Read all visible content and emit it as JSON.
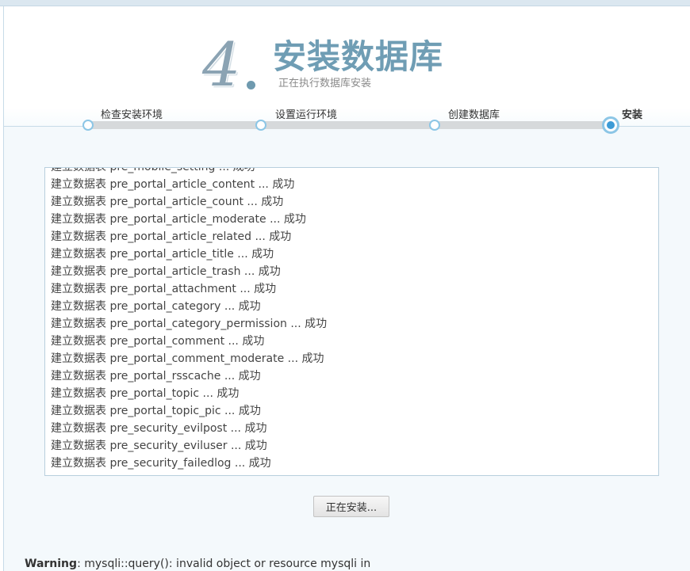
{
  "header": {
    "step_number": "4",
    "title": "安装数据库",
    "subtitle": "正在执行数据库安装"
  },
  "steps": [
    {
      "label": "检查安装环境",
      "state": "done"
    },
    {
      "label": "设置运行环境",
      "state": "done"
    },
    {
      "label": "创建数据库",
      "state": "done"
    },
    {
      "label": "安装",
      "state": "active"
    }
  ],
  "log": {
    "lines": [
      "建立数据表 pre_mobile_setting ... 成功",
      "建立数据表 pre_portal_article_content ... 成功",
      "建立数据表 pre_portal_article_count ... 成功",
      "建立数据表 pre_portal_article_moderate ... 成功",
      "建立数据表 pre_portal_article_related ... 成功",
      "建立数据表 pre_portal_article_title ... 成功",
      "建立数据表 pre_portal_article_trash ... 成功",
      "建立数据表 pre_portal_attachment ... 成功",
      "建立数据表 pre_portal_category ... 成功",
      "建立数据表 pre_portal_category_permission ... 成功",
      "建立数据表 pre_portal_comment ... 成功",
      "建立数据表 pre_portal_comment_moderate ... 成功",
      "建立数据表 pre_portal_rsscache ... 成功",
      "建立数据表 pre_portal_topic ... 成功",
      "建立数据表 pre_portal_topic_pic ... 成功",
      "建立数据表 pre_security_evilpost ... 成功",
      "建立数据表 pre_security_eviluser ... 成功",
      "建立数据表 pre_security_failedlog ... 成功"
    ]
  },
  "button": {
    "label": "正在安装..."
  },
  "warning": {
    "label": "Warning",
    "message": ": mysqli::query(): invalid object or resource mysqli in"
  },
  "colors": {
    "accent": "#6f9db4",
    "progress_node": "#3d9bd6",
    "track": "#d6d9db"
  }
}
